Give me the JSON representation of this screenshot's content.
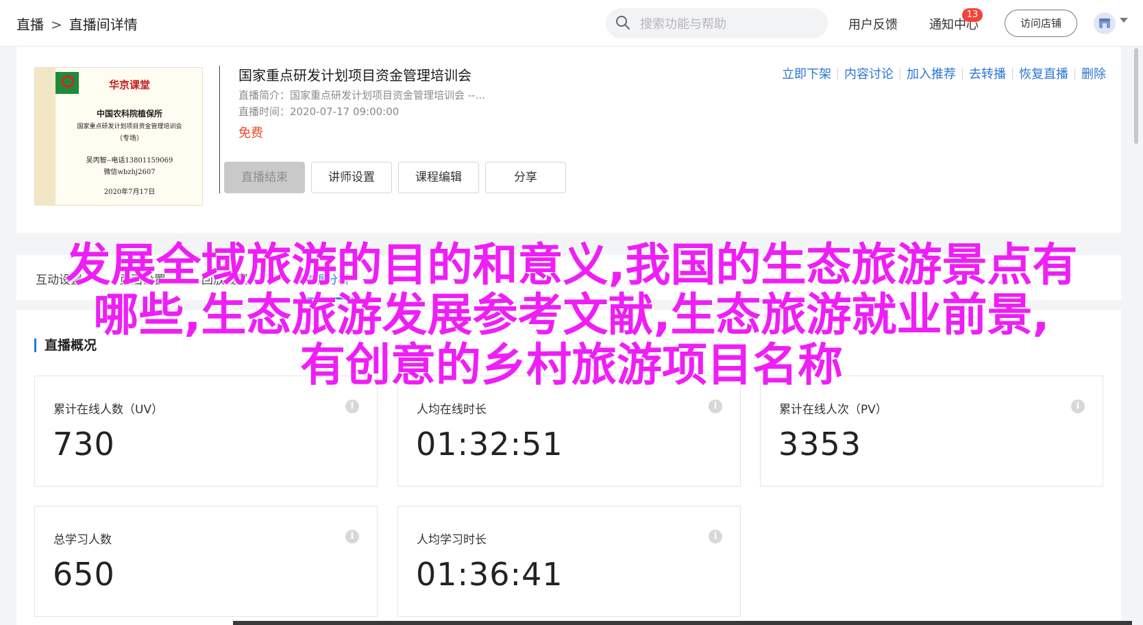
{
  "topbar": {
    "breadcrumb_root": "直播",
    "breadcrumb_sep": ">",
    "breadcrumb_current": "直播间详情",
    "search_placeholder": "搜索功能与帮助",
    "feedback": "用户反馈",
    "notifications": "通知中心",
    "notification_count": "13",
    "visit_store": "访问店铺"
  },
  "course": {
    "cover": {
      "brand": "华京课堂",
      "line1": "中国农科院植保所",
      "line2": "国家重点研发计划项目资金管理培训会",
      "line3": "（专场）",
      "line4": "吴丙智--电话13801159069",
      "line5": "微信wbzhj2607",
      "line6": "2020年7月17日"
    },
    "title": "国家重点研发计划项目资金管理培训会",
    "intro": "直播简介：国家重点研发计划项目资金管理培训会 --...",
    "time": "直播时间：2020-07-17 09:00:00",
    "price": "免费",
    "buttons": {
      "end": "直播结束",
      "teacher": "讲师设置",
      "edit": "课程编辑",
      "share": "分享"
    },
    "actions": [
      "立即下架",
      "内容讨论",
      "加入推荐",
      "去转播",
      "恢复直播",
      "删除"
    ]
  },
  "tabs": [
    "互动设置",
    "页面设置",
    "回放设置",
    "数据分析"
  ],
  "overview": {
    "title": "直播概况",
    "stats": [
      {
        "label": "累计在线人数（UV）",
        "value": "730"
      },
      {
        "label": "人均在线时长",
        "value": "01:32:51"
      },
      {
        "label": "累计在线人次（PV）",
        "value": "3353"
      },
      {
        "label": "总学习人数",
        "value": "650"
      },
      {
        "label": "人均学习时长",
        "value": "01:36:41"
      }
    ]
  },
  "overlay": {
    "line1": "发展全域旅游的目的和意义,我国的生态旅游景点有",
    "line2": "哪些,生态旅游发展参考文献,生态旅游就业前景,",
    "line3": "有创意的乡村旅游项目名称"
  },
  "colors": {
    "accent": "#2b76d6",
    "price": "#ec4a2c",
    "badge": "#f5423b",
    "overlay": "#ef1ef7"
  }
}
